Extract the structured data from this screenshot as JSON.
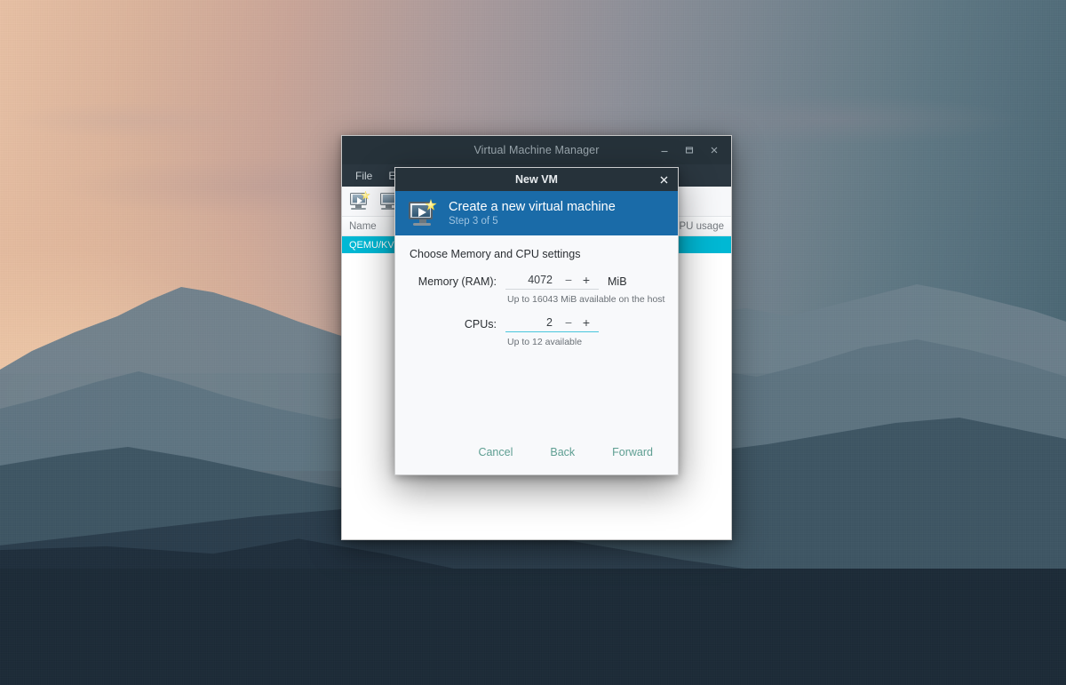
{
  "desktop": {
    "wallpaper_name": "mountain-sunset-wallpaper",
    "colors": {
      "sky_warm": "#e8c0a4",
      "sky_cool": "#4a6673",
      "mountain_far": "#6b7f8c",
      "mountain_near": "#2a3d4c",
      "mountain_front": "#1e2e3c"
    }
  },
  "main_window": {
    "title": "Virtual Machine Manager",
    "window_buttons": {
      "minimize": "minimize",
      "maximize": "maximize",
      "close": "close"
    },
    "menu": [
      "File",
      "Edit"
    ],
    "toolbar": [
      {
        "name": "new-vm",
        "label": "Create a new virtual machine"
      },
      {
        "name": "open-vm",
        "label": "Open"
      }
    ],
    "list": {
      "columns": [
        "Name",
        "CPU usage"
      ],
      "rows": [
        {
          "name": "QEMU/KVM",
          "usage": ""
        }
      ]
    }
  },
  "dialog": {
    "title": "New VM",
    "close_label": "×",
    "banner": {
      "title": "Create a new virtual machine",
      "subtitle": "Step 3 of 5",
      "icon": "new-vm-icon",
      "bg_color": "#1a6ba8"
    },
    "section_label": "Choose Memory and CPU settings",
    "fields": {
      "memory": {
        "label": "Memory (RAM):",
        "value": "4072",
        "minus": "−",
        "plus": "+",
        "unit": "MiB",
        "hint": "Up to 16043 MiB available on the host",
        "focused": false
      },
      "cpus": {
        "label": "CPUs:",
        "value": "2",
        "minus": "−",
        "plus": "+",
        "unit": "",
        "hint": "Up to 12 available",
        "focused": true
      }
    },
    "buttons": {
      "cancel": "Cancel",
      "back": "Back",
      "forward": "Forward"
    },
    "accent_color": "#49c6dd",
    "button_color": "#5e9e92"
  }
}
